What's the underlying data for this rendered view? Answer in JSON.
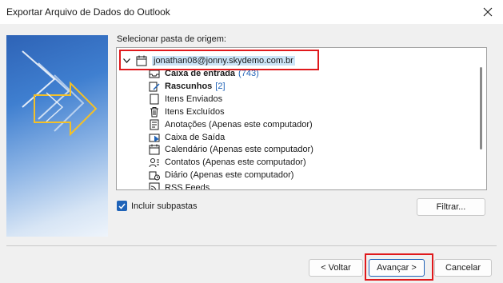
{
  "window": {
    "title": "Exportar Arquivo de Dados do Outlook"
  },
  "source": {
    "label": "Selecionar pasta de origem:"
  },
  "tree": {
    "root": {
      "label": "jonathan08@jonny.skydemo.com.br",
      "icon": "calendar-icon"
    },
    "items": [
      {
        "label": "Caixa de entrada",
        "count": "(743)",
        "icon": "inbox-icon",
        "bold": true
      },
      {
        "label": "Rascunhos",
        "count": "[2]",
        "icon": "drafts-icon",
        "bold": true
      },
      {
        "label": "Itens Enviados",
        "count": "",
        "icon": "folder-icon",
        "bold": false
      },
      {
        "label": "Itens Excluídos",
        "count": "",
        "icon": "trash-icon",
        "bold": false
      },
      {
        "label": "Anotações (Apenas este computador)",
        "count": "",
        "icon": "note-icon",
        "bold": false
      },
      {
        "label": "Caixa de Saída",
        "count": "",
        "icon": "outbox-icon",
        "bold": false
      },
      {
        "label": "Calendário (Apenas este computador)",
        "count": "",
        "icon": "calendar-icon",
        "bold": false
      },
      {
        "label": "Contatos (Apenas este computador)",
        "count": "",
        "icon": "contacts-icon",
        "bold": false
      },
      {
        "label": "Diário (Apenas este computador)",
        "count": "",
        "icon": "journal-icon",
        "bold": false
      },
      {
        "label": "RSS Feeds",
        "count": "",
        "icon": "rss-icon",
        "bold": false
      }
    ]
  },
  "options": {
    "include_subfolders": "Incluir subpastas",
    "include_subfolders_checked": true
  },
  "buttons": {
    "filter": "Filtrar...",
    "back": "< Voltar",
    "next": "Avançar >",
    "cancel": "Cancelar"
  },
  "colors": {
    "accent": "#1f63b8",
    "highlight": "#e0191c",
    "selection": "#cce4f7",
    "count": "#1f63b8"
  }
}
